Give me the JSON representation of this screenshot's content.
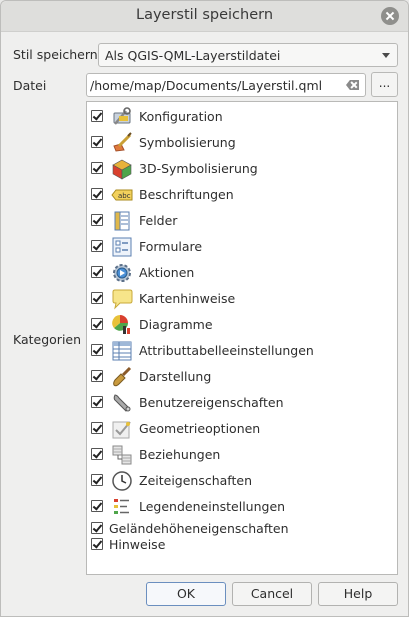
{
  "window": {
    "title": "Layerstil speichern"
  },
  "form": {
    "save_style_label": "Stil speichern",
    "save_style_value": "Als QGIS-QML-Layerstildatei",
    "file_label": "Datei",
    "file_value": "/home/map/Documents/Layerstil.qml",
    "browse_label": "...",
    "categories_label": "Kategorien"
  },
  "categories": [
    {
      "label": "Konfiguration",
      "checked": true,
      "icon": "configuration-icon"
    },
    {
      "label": "Symbolisierung",
      "checked": true,
      "icon": "symbology-icon"
    },
    {
      "label": "3D-Symbolisierung",
      "checked": true,
      "icon": "3d-cube-icon"
    },
    {
      "label": "Beschriftungen",
      "checked": true,
      "icon": "labels-abc-icon"
    },
    {
      "label": "Felder",
      "checked": true,
      "icon": "fields-icon"
    },
    {
      "label": "Formulare",
      "checked": true,
      "icon": "forms-icon"
    },
    {
      "label": "Aktionen",
      "checked": true,
      "icon": "actions-gear-icon"
    },
    {
      "label": "Kartenhinweise",
      "checked": true,
      "icon": "map-tips-bubble-icon"
    },
    {
      "label": "Diagramme",
      "checked": true,
      "icon": "diagrams-icon"
    },
    {
      "label": "Attributtabelleeinstellungen",
      "checked": true,
      "icon": "attribute-table-icon"
    },
    {
      "label": "Darstellung",
      "checked": true,
      "icon": "rendering-brush-icon"
    },
    {
      "label": "Benutzereigenschaften",
      "checked": true,
      "icon": "custom-properties-wrench-icon"
    },
    {
      "label": "Geometrieoptionen",
      "checked": true,
      "icon": "geometry-options-icon"
    },
    {
      "label": "Beziehungen",
      "checked": true,
      "icon": "relations-icon"
    },
    {
      "label": "Zeiteigenschaften",
      "checked": true,
      "icon": "temporal-clock-icon"
    },
    {
      "label": "Legendeneinstellungen",
      "checked": true,
      "icon": "legend-icon"
    },
    {
      "label": "Geländehöheneigenschaften",
      "checked": true,
      "icon": ""
    },
    {
      "label": "Hinweise",
      "checked": true,
      "icon": ""
    }
  ],
  "buttons": {
    "ok": "OK",
    "cancel": "Cancel",
    "help": "Help"
  }
}
